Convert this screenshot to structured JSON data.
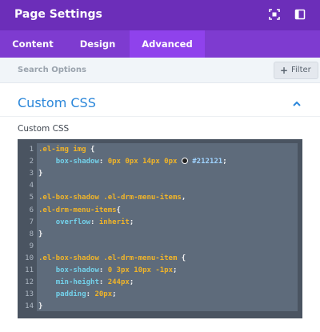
{
  "header": {
    "title": "Page Settings",
    "fullscreen_icon": "fullscreen-icon",
    "sidebar_icon": "sidebar-toggle-icon"
  },
  "tabs": [
    {
      "label": "Content",
      "active": false
    },
    {
      "label": "Design",
      "active": false
    },
    {
      "label": "Advanced",
      "active": true
    }
  ],
  "search": {
    "placeholder": "Search Options"
  },
  "filter": {
    "label": "Filter",
    "icon": "plus-icon"
  },
  "section": {
    "title": "Custom CSS",
    "toggle_icon": "chevron-up-icon"
  },
  "field": {
    "label": "Custom CSS"
  },
  "editor": {
    "line_numbers": [
      "1",
      "2",
      "3",
      "4",
      "5",
      "6",
      "7",
      "8",
      "9",
      "10",
      "11",
      "12",
      "13",
      "14"
    ],
    "lines": [
      [
        {
          "t": ".el-img img",
          "c": "sel"
        },
        {
          "t": " {",
          "c": "plain"
        }
      ],
      [
        {
          "t": "    ",
          "c": "plain"
        },
        {
          "t": "box-shadow",
          "c": "prop"
        },
        {
          "t": ": ",
          "c": "plain"
        },
        {
          "t": "0px 0px 14px 0px",
          "c": "val"
        },
        {
          "t": " ",
          "c": "plain"
        },
        {
          "t": "",
          "c": "swatch"
        },
        {
          "t": "#212121",
          "c": "hex"
        },
        {
          "t": ";",
          "c": "plain"
        }
      ],
      [
        {
          "t": "}",
          "c": "plain"
        }
      ],
      [],
      [
        {
          "t": ".el-box-shadow .el-drm-menu-items",
          "c": "sel"
        },
        {
          "t": ",",
          "c": "plain"
        }
      ],
      [
        {
          "t": ".el-drm-menu-items",
          "c": "sel"
        },
        {
          "t": "{",
          "c": "plain"
        }
      ],
      [
        {
          "t": "    ",
          "c": "plain"
        },
        {
          "t": "overflow",
          "c": "prop"
        },
        {
          "t": ": ",
          "c": "plain"
        },
        {
          "t": "inherit",
          "c": "val"
        },
        {
          "t": ";",
          "c": "plain"
        }
      ],
      [
        {
          "t": "}",
          "c": "plain"
        }
      ],
      [],
      [
        {
          "t": ".el-box-shadow .el-drm-menu-item",
          "c": "sel"
        },
        {
          "t": " {",
          "c": "plain"
        }
      ],
      [
        {
          "t": "    ",
          "c": "plain"
        },
        {
          "t": "box-shadow",
          "c": "prop"
        },
        {
          "t": ": ",
          "c": "plain"
        },
        {
          "t": "0 3px 10px -1px",
          "c": "val"
        },
        {
          "t": ";",
          "c": "plain"
        }
      ],
      [
        {
          "t": "    ",
          "c": "plain"
        },
        {
          "t": "min-height",
          "c": "prop"
        },
        {
          "t": ": ",
          "c": "plain"
        },
        {
          "t": "244px",
          "c": "val"
        },
        {
          "t": ";",
          "c": "plain"
        }
      ],
      [
        {
          "t": "    ",
          "c": "plain"
        },
        {
          "t": "padding",
          "c": "prop"
        },
        {
          "t": ": ",
          "c": "plain"
        },
        {
          "t": "20px",
          "c": "val"
        },
        {
          "t": ";",
          "c": "plain"
        }
      ],
      [
        {
          "t": "}",
          "c": "plain"
        }
      ]
    ]
  },
  "colors": {
    "header_bg": "#6c2eb9",
    "tabs_bg": "#7e3bd0",
    "active_tab_bg": "#8f42ec",
    "section_title": "#2b87da",
    "editor_bg": "#4a5461",
    "selector": "#f0b429",
    "property": "#73d1ea"
  }
}
